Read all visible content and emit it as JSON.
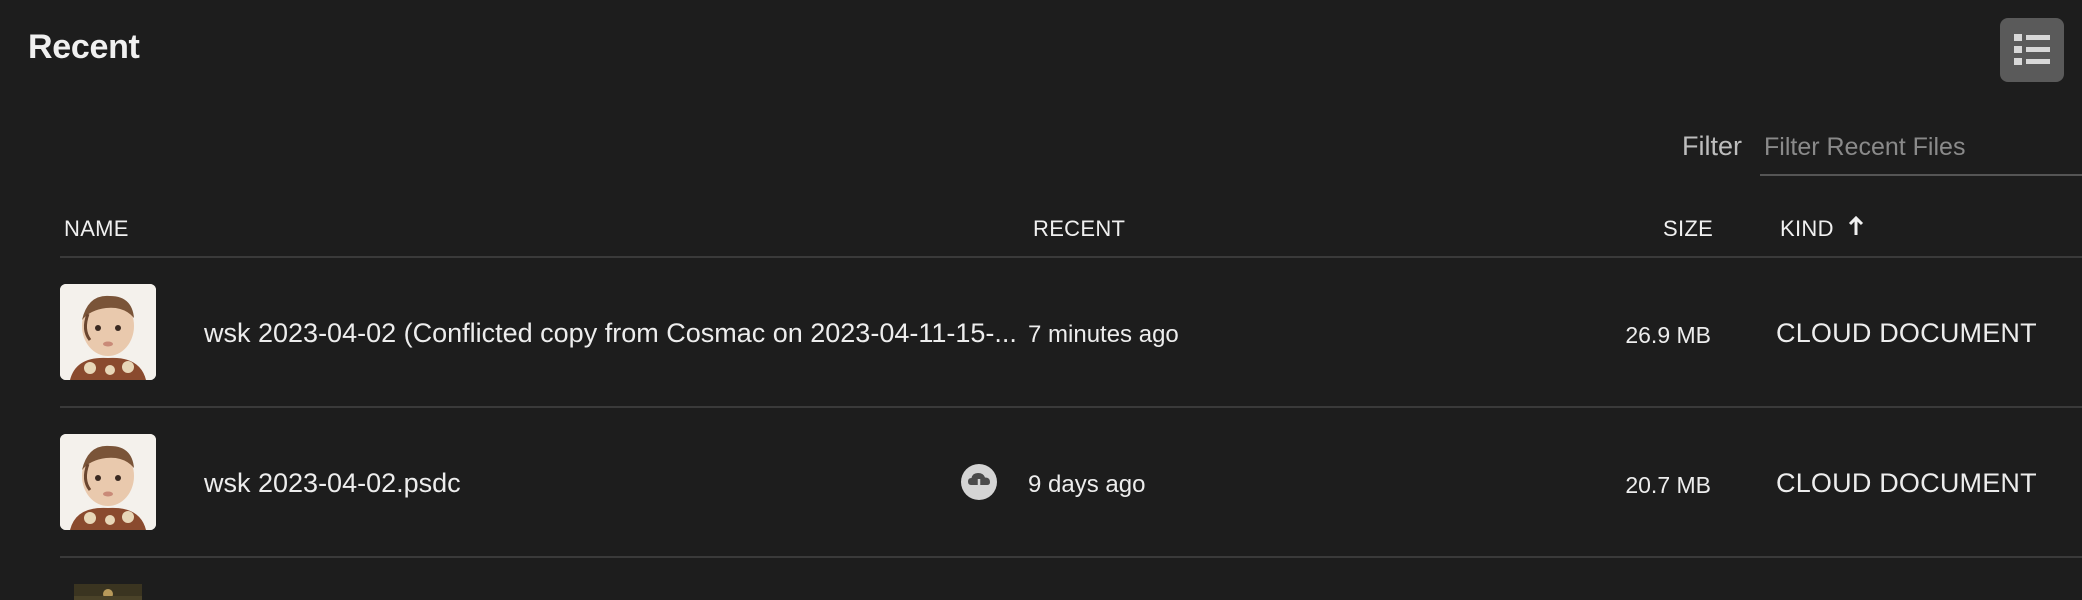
{
  "header": {
    "title": "Recent"
  },
  "filter": {
    "label": "Filter",
    "placeholder": "Filter Recent Files",
    "value": ""
  },
  "table": {
    "columns": {
      "name": "NAME",
      "recent": "RECENT",
      "size": "SIZE",
      "kind": "KIND"
    },
    "sort": {
      "column": "KIND",
      "direction": "ascending"
    },
    "rows": [
      {
        "name": "wsk 2023-04-02 (Conflicted copy from Cosmac on 2023-04-11-15-...",
        "recent": "7 minutes ago",
        "size": "26.9 MB",
        "kind": "CLOUD DOCUMENT",
        "status_icon": ""
      },
      {
        "name": "wsk 2023-04-02.psdc",
        "recent": "9 days ago",
        "size": "20.7 MB",
        "kind": "CLOUD DOCUMENT",
        "status_icon": "cloud-download-icon"
      }
    ]
  },
  "icons": {
    "view_toggle": "list-view-icon",
    "sort": "arrow-up-icon"
  },
  "colors": {
    "background": "#1d1d1d",
    "toggle_bg": "#5a5a5a",
    "divider": "#3a3a3a",
    "text": "#ededed"
  }
}
